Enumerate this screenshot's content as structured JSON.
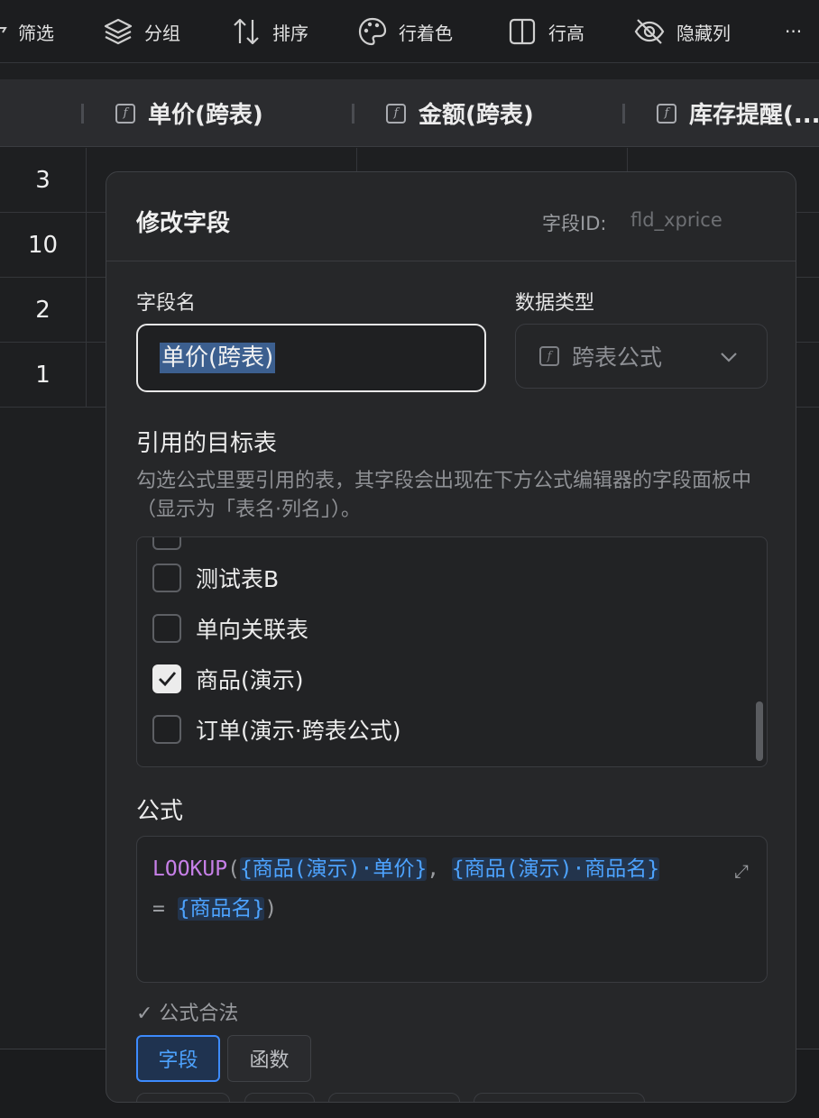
{
  "toolbar": {
    "filter": "筛选",
    "group": "分组",
    "sort": "排序",
    "row_color": "行着色",
    "row_height": "行高",
    "hidden_columns": "隐藏列",
    "more": "···"
  },
  "table": {
    "columns": [
      "单价(跨表)",
      "金额(跨表)",
      "库存提醒(..."
    ],
    "row_numbers": [
      "3",
      "10",
      "2",
      "1"
    ]
  },
  "dialog": {
    "title": "修改字段",
    "field_id_label": "字段ID:",
    "field_id_value": "fld_xprice",
    "field_name_label": "字段名",
    "field_name_value": "单价(跨表)",
    "data_type_label": "数据类型",
    "data_type_value": "跨表公式",
    "ref_tables_title": "引用的目标表",
    "ref_tables_hint": "勾选公式里要引用的表，其字段会出现在下方公式编辑器的字段面板中（显示为「表名·列名」）。",
    "tables": [
      {
        "name": "测试表B",
        "checked": false
      },
      {
        "name": "单向关联表",
        "checked": false
      },
      {
        "name": "商品(演示)",
        "checked": true
      },
      {
        "name": "订单(演示·跨表公式)",
        "checked": false
      }
    ],
    "formula_label": "公式",
    "formula": {
      "fn": "LOOKUP",
      "open": "(",
      "ref1": "{商品(演示)·单价}",
      "comma": ", ",
      "ref2": "{商品(演示)·商品名}",
      "eq": "= ",
      "ref3": "{商品名}",
      "close": ")"
    },
    "valid_text": "✓ 公式合法",
    "tab_fields": "字段",
    "tab_functions": "函数"
  }
}
